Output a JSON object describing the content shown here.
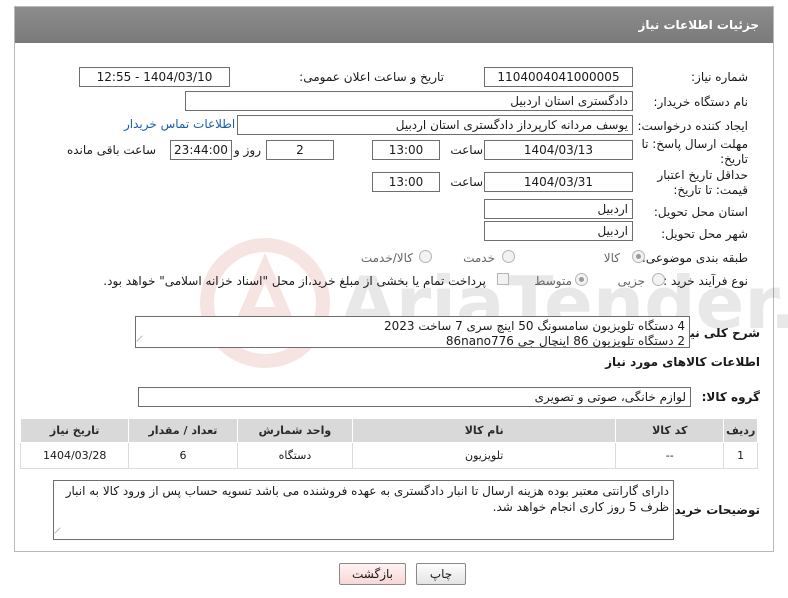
{
  "header": {
    "title": "جزئیات اطلاعات نیاز"
  },
  "fields": {
    "need_number_label": "شماره نیاز:",
    "need_number": "1104004041000005",
    "announce_label": "تاریخ و ساعت اعلان عمومی:",
    "announce_value": "1404/03/10 - 12:55",
    "buyer_org_label": "نام دستگاه خریدار:",
    "buyer_org": "دادگستری استان اردبیل",
    "creator_label": "ایجاد کننده درخواست:",
    "creator": "یوسف  مردانه  کارپرداز دادگستری استان اردبیل",
    "contact_link": "اطلاعات تماس خریدار",
    "reply_deadline_label": "مهلت ارسال پاسخ: تا تاریخ:",
    "reply_date": "1404/03/13",
    "hour_label": "ساعت",
    "reply_time": "13:00",
    "days_value": "2",
    "days_label": "روز و",
    "remaining_time": "23:44:00",
    "remaining_label": "ساعت باقی مانده",
    "validity_label": "حداقل تاریخ اعتبار قیمت: تا تاریخ:",
    "validity_date": "1404/03/31",
    "validity_time": "13:00",
    "delivery_province_label": "استان محل تحویل:",
    "delivery_province": "اردبیل",
    "delivery_city_label": "شهر محل تحویل:",
    "delivery_city": "اردبیل",
    "category_label": "طبقه بندی موضوعی:",
    "category_options": [
      "کالا",
      "خدمت",
      "کالا/خدمت"
    ],
    "process_label": "نوع فرآیند خرید :",
    "process_options": [
      "جزیی",
      "متوسط"
    ],
    "payment_note": "پرداخت تمام یا بخشی از مبلغ خرید،از محل \"اسناد خزانه اسلامی\" خواهد بود.",
    "summary_label": "شرح کلی نیاز:",
    "summary_line1": "4 دستگاه تلویزیون سامسونگ 50 اینچ سری 7 ساخت 2023",
    "summary_line2": "2 دستگاه تلویزیون 86 اینچال جی 86nano776",
    "goods_info_title": "اطلاعات کالاهای مورد نیاز",
    "goods_group_label": "گروه کالا:",
    "goods_group": "لوازم خانگی، صوتی و تصویری",
    "buyer_notes_label": "توضیحات خریدار:",
    "buyer_notes": "دارای گارانتی معتبر بوده هزینه ارسال تا انبار دادگستری به عهده فروشنده می باشد تسویه حساب پس از ورود کالا به انبار ظرف 5 روز کاری انجام خواهد شد."
  },
  "table": {
    "headers": [
      "ردیف",
      "کد کالا",
      "نام کالا",
      "واحد شمارش",
      "تعداد / مقدار",
      "تاریخ نیاز"
    ],
    "rows": [
      [
        "1",
        "--",
        "تلویزیون",
        "دستگاه",
        "6",
        "1404/03/28"
      ]
    ]
  },
  "buttons": {
    "print": "چاپ",
    "back": "بازگشت"
  },
  "watermark": "AriaTender.neT",
  "colors": {
    "header_bg": "#808080",
    "link": "#1a5fa8",
    "back_btn": "#f7d6d6"
  }
}
